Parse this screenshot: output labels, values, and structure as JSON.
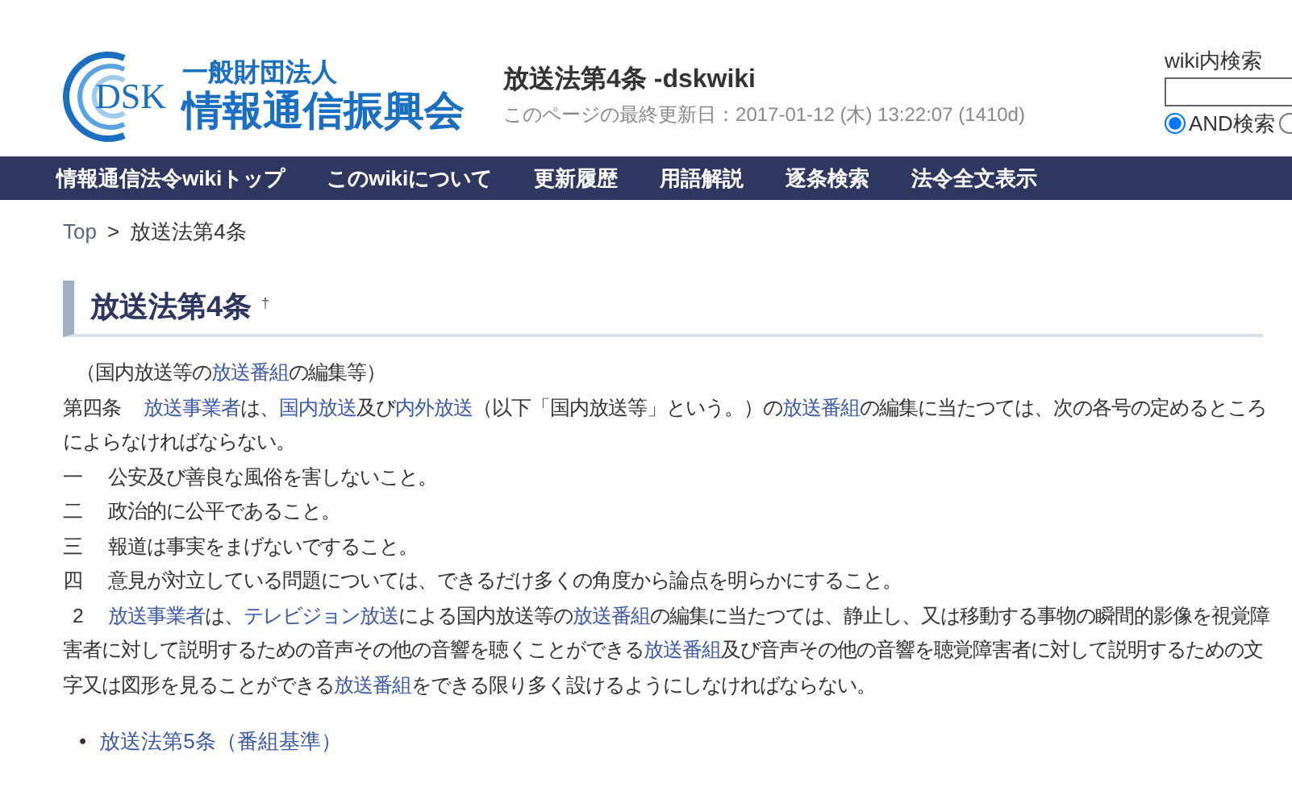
{
  "logo": {
    "mark": "DSK",
    "org_type": "一般財団法人",
    "org_name": "情報通信振興会"
  },
  "page": {
    "title": "放送法第4条 -dskwiki",
    "last_modified": "このページの最終更新日：2017-01-12 (木) 13:22:07 (1410d)"
  },
  "search": {
    "label": "wiki内検索",
    "options": [
      {
        "label": "AND検索",
        "selected": true
      },
      {
        "selected": false
      }
    ]
  },
  "nav": [
    "情報通信法令wikiトップ",
    "このwikiについて",
    "更新履歴",
    "用語解説",
    "逐条検索",
    "法令全文表示"
  ],
  "breadcrumb": {
    "link": "Top",
    "separator": ">",
    "current": "放送法第4条"
  },
  "heading": {
    "text": "放送法第4条",
    "anchor": "†"
  },
  "lines": [
    {
      "kind": "caption",
      "segments": [
        {
          "text": "（国内放送等の"
        },
        {
          "text": "放送番組",
          "link": true
        },
        {
          "text": "の編集等）"
        }
      ]
    },
    {
      "kind": "article",
      "number": "第四条",
      "segments": [
        {
          "text": "放送事業者",
          "link": true
        },
        {
          "text": "は、"
        },
        {
          "text": "国内放送",
          "link": true
        },
        {
          "text": "及び"
        },
        {
          "text": "内外放送",
          "link": true
        },
        {
          "text": "（以下「国内放送等」という。）の"
        },
        {
          "text": "放送番組",
          "link": true
        },
        {
          "text": "の編集に当たつては、次の各号の定めるところによらなければならない。"
        }
      ]
    },
    {
      "kind": "item",
      "number": "一",
      "segments": [
        {
          "text": "公安及び善良な風俗を害しないこと。"
        }
      ]
    },
    {
      "kind": "item",
      "number": "二",
      "segments": [
        {
          "text": "政治的に公平であること。"
        }
      ]
    },
    {
      "kind": "item",
      "number": "三",
      "segments": [
        {
          "text": "報道は事実をまげないですること。"
        }
      ]
    },
    {
      "kind": "item",
      "number": "四",
      "segments": [
        {
          "text": "意見が対立している問題については、できるだけ多くの角度から論点を明らかにすること。"
        }
      ]
    },
    {
      "kind": "paragraph",
      "number": "2",
      "segments": [
        {
          "text": "放送事業者",
          "link": true
        },
        {
          "text": "は、"
        },
        {
          "text": "テレビジョン放送",
          "link": true
        },
        {
          "text": "による国内放送等の"
        },
        {
          "text": "放送番組",
          "link": true
        },
        {
          "text": "の編集に当たつては、静止し、又は移動する事物の瞬間的影像を視覚障害者に対して説明するための音声その他の音響を聴くことができる"
        },
        {
          "text": "放送番組",
          "link": true
        },
        {
          "text": "及び音声その他の音響を聴覚障害者に対して説明するための文字又は図形を見ることができる"
        },
        {
          "text": "放送番組",
          "link": true
        },
        {
          "text": "をできる限り多く設けるようにしなければならない。"
        }
      ]
    }
  ],
  "related": [
    {
      "bullet": "•",
      "text": "放送法第5条（番組基準）"
    }
  ]
}
